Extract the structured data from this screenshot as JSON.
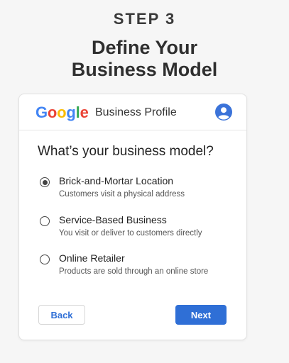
{
  "hero": {
    "step": "STEP 3",
    "title_line1": "Define Your",
    "title_line2": "Business Model"
  },
  "header": {
    "logo_letters": [
      "G",
      "o",
      "o",
      "g",
      "l",
      "e"
    ],
    "product": "Business Profile",
    "avatar_icon": "account-circle-icon",
    "brand_colors": [
      "#4285F4",
      "#EA4335",
      "#FBBC05",
      "#4285F4",
      "#34A853",
      "#EA4335"
    ]
  },
  "form": {
    "question": "What’s your business model?",
    "options": [
      {
        "title": "Brick-and-Mortar Location",
        "description": "Customers visit a physical address",
        "selected": true
      },
      {
        "title": "Service-Based Business",
        "description": "You visit or deliver to customers directly",
        "selected": false
      },
      {
        "title": "Online Retailer",
        "description": "Products are sold through an online store",
        "selected": false
      }
    ]
  },
  "actions": {
    "back_label": "Back",
    "next_label": "Next",
    "primary_color": "#2f6fd6"
  }
}
